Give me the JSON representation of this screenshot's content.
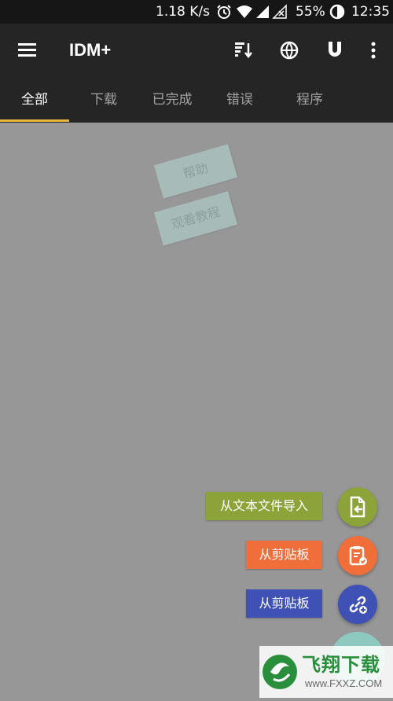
{
  "status_bar": {
    "network_speed": "1.18 K/s",
    "battery": "55%",
    "time": "12:35"
  },
  "app_bar": {
    "title": "IDM+",
    "icons": [
      "menu-icon",
      "sort-icon",
      "browser-icon",
      "magnet-icon",
      "more-icon"
    ]
  },
  "tabs": [
    {
      "label": "全部",
      "active": true
    },
    {
      "label": "下载",
      "active": false
    },
    {
      "label": "已完成",
      "active": false
    },
    {
      "label": "错误",
      "active": false
    },
    {
      "label": "程序",
      "active": false
    }
  ],
  "help": {
    "help_label": "帮助",
    "tutorial_label": "观看教程"
  },
  "fab_menu": {
    "items": [
      {
        "label": "从文本文件导入",
        "color": "#8ca33a",
        "icon": "file-import-icon"
      },
      {
        "label": "从剪贴板",
        "color": "#ef6e3a",
        "icon": "clipboard-check-icon"
      },
      {
        "label": "从剪贴板",
        "color": "#3f51b5",
        "icon": "add-link-icon"
      }
    ]
  },
  "colors": {
    "accent": "#e7b53c",
    "toolbar": "#252525",
    "background": "#979797"
  },
  "watermark": {
    "title": "飞翔下载",
    "url": "www.FXXZ.COM"
  }
}
